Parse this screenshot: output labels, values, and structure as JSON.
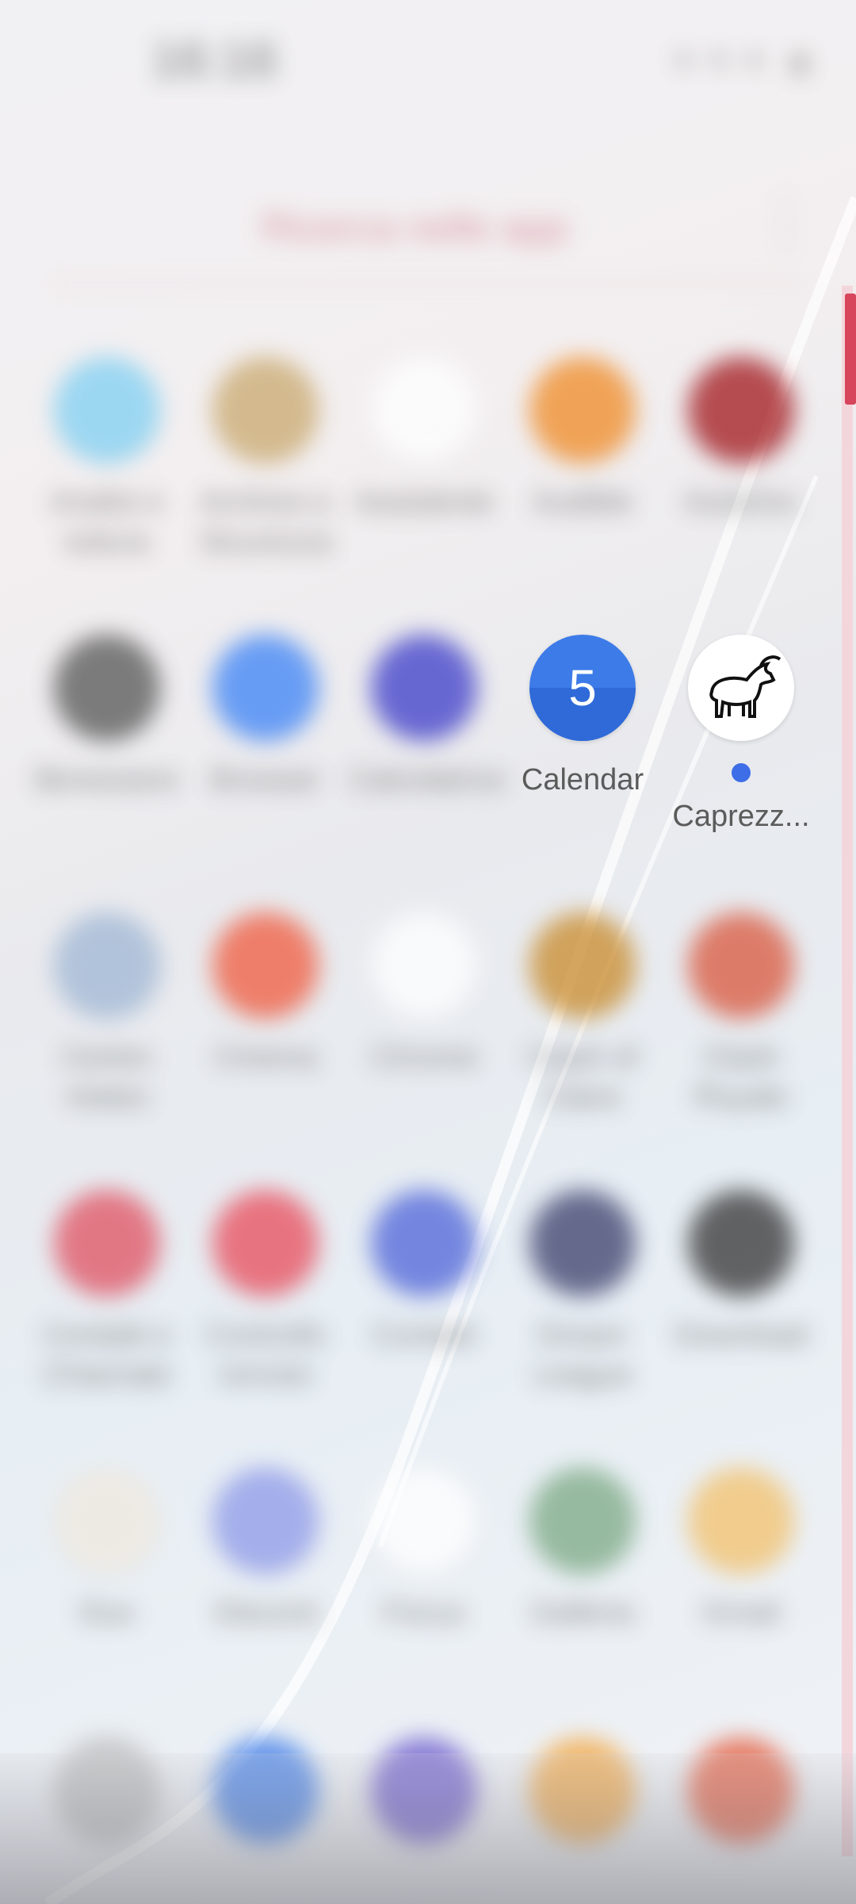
{
  "status_bar": {
    "clock": "16:16",
    "icons": "◔◔◔ ◐"
  },
  "search": {
    "text": "Ricerca nelle app"
  },
  "apps": [
    {
      "id": "row1-1",
      "label": "Analisi e tuttura",
      "color": "#7fcff2",
      "blurred": true
    },
    {
      "id": "row1-2",
      "label": "Archivio e Sicurezza",
      "color": "#c9a86d",
      "blurred": true
    },
    {
      "id": "row1-3",
      "label": "Assistente",
      "color": "#ffffff",
      "blurred": true
    },
    {
      "id": "row1-4",
      "label": "Audible",
      "color": "#f08a24",
      "blurred": true
    },
    {
      "id": "row1-5",
      "label": "AutoDoc",
      "color": "#a1161b",
      "blurred": true
    },
    {
      "id": "row2-1",
      "label": "Benessere",
      "color": "#555555",
      "blurred": true
    },
    {
      "id": "row2-2",
      "label": "Browser",
      "color": "#3b82f6",
      "blurred": true
    },
    {
      "id": "row2-3",
      "label": "Calcolatrice",
      "color": "#3b3bc9",
      "blurred": true
    },
    {
      "id": "row2-4",
      "label": "Calendar",
      "day": "5",
      "blurred": false
    },
    {
      "id": "row2-5",
      "label": "Caprezz...",
      "color": "#ffffff",
      "blurred": false,
      "dot": true
    },
    {
      "id": "row3-1",
      "label": "Centro meteo",
      "color": "#9fb6d4",
      "blurred": true
    },
    {
      "id": "row3-2",
      "label": "Cinema",
      "color": "#f05a3d",
      "blurred": true
    },
    {
      "id": "row3-3",
      "label": "Chrome",
      "color": "#ffffff",
      "blurred": true
    },
    {
      "id": "row3-4",
      "label": "Clash of Clans",
      "color": "#c88a2a",
      "blurred": true
    },
    {
      "id": "row3-5",
      "label": "Clash Royale",
      "color": "#d9563b",
      "blurred": true
    },
    {
      "id": "row4-1",
      "label": "Contatti e Chiamate",
      "color": "#e05060",
      "blurred": true
    },
    {
      "id": "row4-2",
      "label": "Controllo remoto",
      "color": "#e84b5a",
      "blurred": true
    },
    {
      "id": "row4-3",
      "label": "Contatti",
      "color": "#4d63d9",
      "blurred": true
    },
    {
      "id": "row4-4",
      "label": "Dream League",
      "color": "#3a3f6b",
      "blurred": true
    },
    {
      "id": "row4-5",
      "label": "Download",
      "color": "#333333",
      "blurred": true
    },
    {
      "id": "row5-1",
      "label": "Duo",
      "color": "#efe9df",
      "blurred": true
    },
    {
      "id": "row5-2",
      "label": "Discord",
      "color": "#8d99e8",
      "blurred": true
    },
    {
      "id": "row5-3",
      "label": "Focus",
      "color": "#ffffff",
      "blurred": true
    },
    {
      "id": "row5-4",
      "label": "Galleria",
      "color": "#7aa883",
      "blurred": true
    },
    {
      "id": "row5-5",
      "label": "Gmail",
      "color": "#f3c16b",
      "blurred": true
    },
    {
      "id": "row6-1",
      "label": "",
      "color": "#bbbbbb",
      "blurred": true
    },
    {
      "id": "row6-2",
      "label": "",
      "color": "#3d7be8",
      "blurred": true
    },
    {
      "id": "row6-3",
      "label": "",
      "color": "#6a5acd",
      "blurred": true
    },
    {
      "id": "row6-4",
      "label": "",
      "color": "#f3a742",
      "blurred": true
    },
    {
      "id": "row6-5",
      "label": "",
      "color": "#e55a3a",
      "blurred": true
    }
  ]
}
